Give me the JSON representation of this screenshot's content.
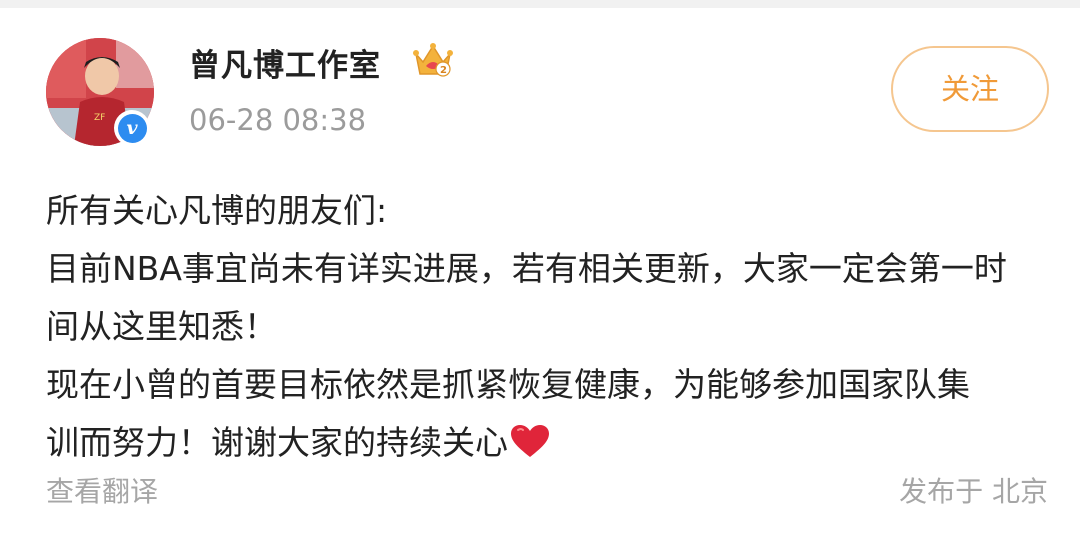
{
  "post": {
    "author": "曾凡博工作室",
    "timestamp": "06-28 08:38",
    "follow_label": "关注",
    "lines": [
      "所有关心凡博的朋友们:",
      "目前NBA事宜尚未有详实进展，若有相关更新，大家一定会第一时",
      "间从这里知悉！",
      "现在小曾的首要目标依然是抓紧恢复健康，为能够参加国家队集",
      "训而努力！谢谢大家的持续关心"
    ],
    "translate_label": "查看翻译",
    "location": "发布于 北京",
    "badge_level": "2"
  },
  "icons": {
    "verified": "verified-v-icon",
    "crown": "crown-level-icon",
    "heart": "red-heart-emoji"
  },
  "colors": {
    "follow_text": "#f09a38",
    "follow_border": "#f5c68f",
    "verified_blue": "#2d8cf0",
    "muted_text": "#9b9b9b",
    "heart_red": "#e0253a"
  }
}
